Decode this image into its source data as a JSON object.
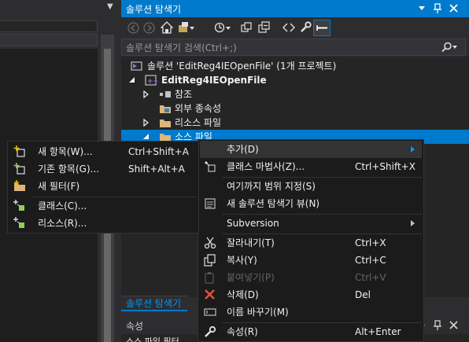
{
  "left": {
    "marker": "▼"
  },
  "solution_explorer": {
    "title": "솔루션 탐색기",
    "search_placeholder": "솔루션 탐색기 검색(Ctrl+;)",
    "tree": {
      "solution": "솔루션 'EditReg4IEOpenFile' (1개 프로젝트)",
      "project": "EditReg4IEOpenFile",
      "references": "참조",
      "external_deps": "외부 종속성",
      "resource_files": "리소스 파일",
      "source_files": "소스 파일"
    },
    "tab_label": "솔루션 탐색기"
  },
  "properties": {
    "title": "속성",
    "row_text": "소스 파일 필터"
  },
  "context_menu": {
    "items": [
      {
        "label": "추가(D)",
        "shortcut": "",
        "submenu": true,
        "icon": ""
      },
      {
        "label": "클래스 마법사(Z)...",
        "shortcut": "Ctrl+Shift+X",
        "icon": "class-wizard-icon"
      },
      {
        "label": "여기까지 범위 지정(S)",
        "shortcut": "",
        "icon": ""
      },
      {
        "label": "새 솔루션 탐색기 뷰(N)",
        "shortcut": "",
        "icon": "new-view-icon"
      },
      {
        "label": "Subversion",
        "shortcut": "",
        "submenu": true,
        "icon": ""
      },
      {
        "label": "잘라내기(T)",
        "shortcut": "Ctrl+X",
        "icon": "cut-icon"
      },
      {
        "label": "복사(Y)",
        "shortcut": "Ctrl+C",
        "icon": "copy-icon"
      },
      {
        "label": "붙여넣기(P)",
        "shortcut": "Ctrl+V",
        "disabled": true,
        "icon": "paste-icon"
      },
      {
        "label": "삭제(D)",
        "shortcut": "Del",
        "icon": "delete-icon"
      },
      {
        "label": "이름 바꾸기(M)",
        "shortcut": "",
        "icon": "rename-icon"
      },
      {
        "label": "속성(R)",
        "shortcut": "Alt+Enter",
        "icon": "wrench-icon"
      }
    ]
  },
  "add_submenu": {
    "items": [
      {
        "label": "새 항목(W)...",
        "shortcut": "Ctrl+Shift+A",
        "icon": "new-item-icon"
      },
      {
        "label": "기존 항목(G)...",
        "shortcut": "Shift+Alt+A",
        "icon": "existing-item-icon"
      },
      {
        "label": "새 필터(F)",
        "shortcut": "",
        "icon": "new-filter-icon"
      },
      {
        "label": "클래스(C)...",
        "shortcut": "",
        "icon": "class-icon"
      },
      {
        "label": "리소스(R)...",
        "shortcut": "",
        "icon": "resource-icon"
      }
    ]
  },
  "colors": {
    "accent": "#007acc",
    "background": "#2d2d30",
    "menu_bg": "#1b1b1c",
    "text": "#f1f1f1",
    "disabled": "#656565"
  }
}
